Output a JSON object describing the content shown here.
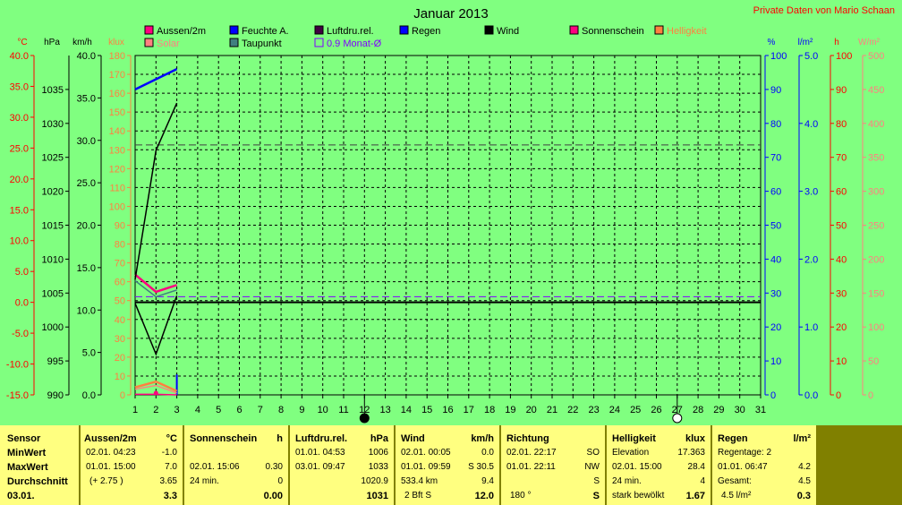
{
  "title": "Januar 2013",
  "owner": "Private Daten von   Mario Schaan",
  "colors": {
    "background": "#80ff80",
    "plot": "#80ff80",
    "grid": "#000000",
    "footer_bg": "#ffff80",
    "footer_frame": "#808000"
  },
  "legend": [
    {
      "label": "Aussen/2m",
      "color": "#ff0080"
    },
    {
      "label": "Solar",
      "color": "#ff8080"
    },
    {
      "label": "Feuchte A.",
      "color": "#0000ff"
    },
    {
      "label": "Taupunkt",
      "color": "#408080"
    },
    {
      "label": "Luftdru.rel.",
      "color": "#400040"
    },
    {
      "label": "0.9 Monat-Ø",
      "color": "#8000ff"
    },
    {
      "label": "Regen",
      "color": "#0000ff"
    },
    {
      "label": "Wind",
      "color": "#000000"
    },
    {
      "label": "Sonnenschein",
      "color": "#ff0080"
    },
    {
      "label": "Helligkeit",
      "color": "#ff8040"
    }
  ],
  "axes": {
    "temp": {
      "unit": "°C",
      "ticks": [
        "40.0",
        "35.0",
        "30.0",
        "25.0",
        "20.0",
        "15.0",
        "10.0",
        "5.0",
        "0.0",
        "-5.0",
        "-10.0",
        "-15.0"
      ],
      "range": [
        -15,
        40
      ],
      "color": "#ff0000"
    },
    "pressure": {
      "unit": "hPa",
      "ticks": [
        "1035",
        "1030",
        "1025",
        "1020",
        "1015",
        "1010",
        "1005",
        "1000",
        "995",
        "990"
      ],
      "range": [
        990,
        1040
      ],
      "color": "#000000"
    },
    "wind": {
      "unit": "km/h",
      "ticks": [
        "40.0",
        "35.0",
        "30.0",
        "25.0",
        "20.0",
        "15.0",
        "10.0",
        "5.0",
        "0.0"
      ],
      "range": [
        0,
        40
      ],
      "color": "#000000"
    },
    "klux": {
      "unit": "klux",
      "ticks": [
        "180",
        "170",
        "160",
        "150",
        "140",
        "130",
        "120",
        "110",
        "100",
        "90",
        "80",
        "70",
        "60",
        "50",
        "40",
        "30",
        "20",
        "10",
        "0"
      ],
      "range": [
        0,
        180
      ],
      "color": "#ff8040"
    },
    "humidity": {
      "unit": "%",
      "ticks": [
        "100",
        "90",
        "80",
        "70",
        "60",
        "50",
        "40",
        "30",
        "20",
        "10",
        "0"
      ],
      "range": [
        0,
        100
      ],
      "color": "#0000ff"
    },
    "rain": {
      "unit": "l/m²",
      "ticks": [
        "5.0",
        "4.0",
        "3.0",
        "2.0",
        "1.0",
        "0.0"
      ],
      "range": [
        0,
        5
      ],
      "color": "#0000ff"
    },
    "sunshine": {
      "unit": "h",
      "ticks": [
        "100",
        "90",
        "80",
        "70",
        "60",
        "50",
        "40",
        "30",
        "20",
        "10",
        "0"
      ],
      "range": [
        0,
        100
      ],
      "color": "#ff0000"
    },
    "solar": {
      "unit": "W/m²",
      "ticks": [
        "500",
        "450",
        "400",
        "350",
        "300",
        "250",
        "200",
        "150",
        "100",
        "50",
        "0"
      ],
      "range": [
        0,
        500
      ],
      "color": "#ff8080"
    }
  },
  "x_ticks": [
    "1",
    "2",
    "3",
    "4",
    "5",
    "6",
    "7",
    "8",
    "9",
    "10",
    "11",
    "12",
    "13",
    "14",
    "15",
    "16",
    "17",
    "18",
    "19",
    "20",
    "21",
    "22",
    "23",
    "24",
    "25",
    "26",
    "27",
    "28",
    "29",
    "30",
    "31"
  ],
  "chart_data": {
    "type": "line",
    "title": "Januar 2013",
    "x": [
      1,
      2,
      3
    ],
    "xlim": [
      1,
      31
    ],
    "grid": true,
    "legend_position": "top",
    "series": [
      {
        "name": "Aussen/2m",
        "axis": "temp",
        "color": "#ff0080",
        "values": [
          4.5,
          1.7,
          2.8
        ]
      },
      {
        "name": "Feuchte A.",
        "axis": "humidity",
        "color": "#0000ff",
        "values": [
          90,
          93,
          96
        ]
      },
      {
        "name": "Taupunkt",
        "axis": "temp",
        "color": "#408080",
        "values": [
          3.5,
          0.9,
          2.0
        ]
      },
      {
        "name": "Luftdru.rel.",
        "axis": "pressure",
        "color": "#000000",
        "values": [
          1007,
          1026,
          1033
        ]
      },
      {
        "name": "Wind",
        "axis": "wind",
        "color": "#000000",
        "values": [
          10.8,
          4.8,
          11.7
        ]
      },
      {
        "name": "Regen",
        "axis": "rain",
        "color": "#0000ff",
        "values": [
          0.0,
          0.0,
          0.3
        ]
      },
      {
        "name": "Helligkeit",
        "axis": "klux",
        "color": "#ff8040",
        "values": [
          4,
          7,
          2
        ]
      },
      {
        "name": "Solar",
        "axis": "klux",
        "color": "#ff8080",
        "values": [
          3,
          5,
          1
        ]
      },
      {
        "name": "Sonnenschein",
        "axis": "klux",
        "color": "#ff0080",
        "values": [
          0.3,
          0.3,
          0.0
        ]
      }
    ],
    "reference_lines": [
      {
        "axis": "temp",
        "value": 25.5,
        "color": "#404040",
        "style": "dashed"
      },
      {
        "axis": "temp",
        "value": 0.9,
        "color": "#8000ff",
        "style": "dashed"
      },
      {
        "axis": "temp",
        "value": 0.0,
        "color": "#000000",
        "style": "solid"
      }
    ],
    "markers": [
      {
        "x": 12,
        "kind": "filled"
      },
      {
        "x": 27,
        "kind": "open"
      }
    ]
  },
  "footer": {
    "sensor": {
      "header": "Sensor",
      "rows": [
        "MinWert",
        "MaxWert",
        "Durchschnitt",
        "03.01."
      ]
    },
    "aussen": {
      "header": "Aussen/2m",
      "unit": "°C",
      "min_time": "02.01.  04:23",
      "min_val": "-1.0",
      "max_time": "01.01.  15:00",
      "max_val": "7.0",
      "avg_note": "(+ 2.75 )",
      "avg_val": "3.65",
      "cur_val": "3.3"
    },
    "sonne": {
      "header": "Sonnenschein",
      "unit": "h",
      "max_time": "02.01.  15:06",
      "max_val": "0.30",
      "avg_note": "24 min.",
      "avg_val": "0",
      "cur_val": "0.00"
    },
    "druck": {
      "header": "Luftdru.rel.",
      "unit": "hPa",
      "min_time": "01.01.  04:53",
      "min_val": "1006",
      "max_time": "03.01.  09:47",
      "max_val": "1033",
      "avg_val": "1020.9",
      "cur_val": "1031"
    },
    "wind": {
      "header": "Wind",
      "unit": "km/h",
      "min_time": "02.01.  00:05",
      "min_val": "0.0",
      "max_time": "01.01.  09:59",
      "max_val": "S  30.5",
      "avg_note": "533.4 km",
      "avg_val": "9.4",
      "cur_note": "2 Bft S",
      "cur_val": "12.0"
    },
    "richtung": {
      "header": "Richtung",
      "min_time": "02.01.  22:17",
      "min_val": "SO",
      "max_time": "01.01.  22:11",
      "max_val": "NW",
      "avg_val": "S",
      "cur_note": "180 °",
      "cur_val": "S"
    },
    "hell": {
      "header": "Helligkeit",
      "unit": "klux",
      "r1_label": "Elevation",
      "r1_val": "17.363",
      "max_time": "02.01.  15:00",
      "max_val": "28.4",
      "avg_note": "24 min.",
      "avg_val": "4",
      "cur_note": "stark bewölkt",
      "cur_val": "1.67"
    },
    "regen": {
      "header": "Regen",
      "unit": "l/m²",
      "r1_label": "Regentage: 2",
      "max_time": "01.01.  06:47",
      "max_val": "4.2",
      "avg_note": "Gesamt:",
      "avg_val": "4.5",
      "cur_note": "4.5 l/m²",
      "cur_val": "0.3"
    }
  }
}
